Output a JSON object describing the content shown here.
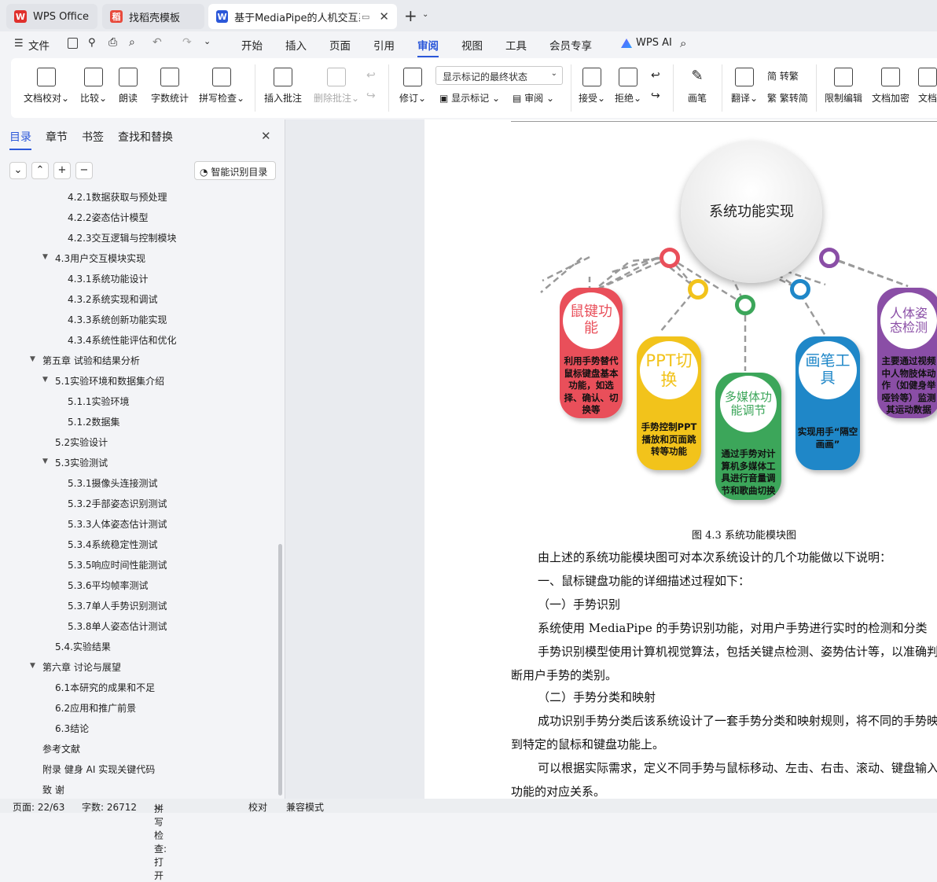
{
  "tabs": [
    {
      "label": "WPS Office"
    },
    {
      "label": "找稻壳模板"
    },
    {
      "label": "基于MediaPipe的人机交互系"
    }
  ],
  "menu": {
    "file": "文件",
    "items": [
      "开始",
      "插入",
      "页面",
      "引用",
      "审阅",
      "视图",
      "工具",
      "会员专享"
    ],
    "ai": "WPS AI"
  },
  "ribbon": {
    "proof": "文档校对",
    "compare": "比较",
    "read": "朗读",
    "wordcount": "字数统计",
    "spell": "拼写检查",
    "insert_comment": "插入批注",
    "delete_comment": "删除批注",
    "revise": "修订",
    "markup_select": "显示标记的最终状态",
    "show_markup": "显示标记",
    "review": "审阅",
    "accept": "接受",
    "reject": "拒绝",
    "pen": "画笔",
    "translate": "翻译",
    "to_trad": "转繁",
    "to_simp": "繁转简",
    "restrict": "限制编辑",
    "encrypt": "文档加密",
    "more": "文档"
  },
  "panel": {
    "tabs": [
      "目录",
      "章节",
      "书签",
      "查找和替换"
    ],
    "smart_toc": "智能识别目录"
  },
  "toc": [
    {
      "text": "4.2.1数据获取与预处理",
      "level": 3
    },
    {
      "text": "4.2.2姿态估计模型",
      "level": 3
    },
    {
      "text": "4.2.3交互逻辑与控制模块",
      "level": 3
    },
    {
      "text": "4.3用户交互模块实现",
      "level": 2,
      "arrow": true
    },
    {
      "text": "4.3.1系统功能设计",
      "level": 3
    },
    {
      "text": "4.3.2系统实现和调试",
      "level": 3
    },
    {
      "text": "4.3.3系统创新功能实现",
      "level": 3
    },
    {
      "text": "4.3.4系统性能评估和优化",
      "level": 3
    },
    {
      "text": "第五章 试验和结果分析",
      "level": 1,
      "arrow": true
    },
    {
      "text": "5.1实验环境和数据集介绍",
      "level": 2,
      "arrow": true
    },
    {
      "text": "5.1.1实验环境",
      "level": 3
    },
    {
      "text": "5.1.2数据集",
      "level": 3
    },
    {
      "text": "5.2实验设计",
      "level": 2
    },
    {
      "text": "5.3实验测试",
      "level": 2,
      "arrow": true
    },
    {
      "text": "5.3.1摄像头连接测试",
      "level": 3
    },
    {
      "text": "5.3.2手部姿态识别测试",
      "level": 3
    },
    {
      "text": "5.3.3人体姿态估计测试",
      "level": 3
    },
    {
      "text": "5.3.4系统稳定性测试",
      "level": 3
    },
    {
      "text": "5.3.5响应时间性能测试",
      "level": 3
    },
    {
      "text": "5.3.6平均帧率测试",
      "level": 3
    },
    {
      "text": "5.3.7单人手势识别测试",
      "level": 3
    },
    {
      "text": "5.3.8单人姿态估计测试",
      "level": 3
    },
    {
      "text": "5.4.实验结果",
      "level": 2
    },
    {
      "text": "第六章 讨论与展望",
      "level": 1,
      "arrow": true
    },
    {
      "text": "6.1本研究的成果和不足",
      "level": 2
    },
    {
      "text": "6.2应用和推广前景",
      "level": 2
    },
    {
      "text": "6.3结论",
      "level": 2
    },
    {
      "text": "参考文献",
      "level": 1
    },
    {
      "text": "附录 健身 AI 实现关键代码",
      "level": 1
    },
    {
      "text": "致 谢",
      "level": 1
    }
  ],
  "figure": {
    "center": "系统功能实现",
    "caption": "图 4.3 系统功能模块图",
    "modules": [
      {
        "title": "鼠键功能",
        "desc": "利用手势替代鼠标键盘基本功能，如选择、确认、切换等",
        "color": "#e94f5a"
      },
      {
        "title": "PPT切换",
        "desc": "手势控制PPT播放和页面跳转等功能",
        "color": "#f2c31b"
      },
      {
        "title": "多媒体功能调节",
        "desc": "通过手势对计算机多媒体工具进行音量调节和歌曲切换",
        "color": "#3ca65a"
      },
      {
        "title": "画笔工具",
        "desc": "实现用手“隔空画画”",
        "color": "#1f87c8"
      },
      {
        "title": "人体姿态检测",
        "desc": "主要通过视频中人物肢体动作（如健身举哑铃等）监测其运动数据",
        "color": "#8a4ea6"
      }
    ]
  },
  "doc": {
    "p1": "由上述的系统功能模块图可对本次系统设计的几个功能做以下说明：",
    "p2": "一、鼠标键盘功能的详细描述过程如下：",
    "p3": "（一）手势识别",
    "p4": "系统使用 MediaPipe 的手势识别功能，对用户手势进行实时的检测和分类",
    "p5": "手势识别模型使用计算机视觉算法，包括关键点检测、姿势估计等，以准确判",
    "p6": "断用户手势的类别。",
    "p7": "（二）手势分类和映射",
    "p8": "成功识别手势分类后该系统设计了一套手势分类和映射规则，将不同的手势映",
    "p9": "到特定的鼠标和键盘功能上。",
    "p10": "可以根据实际需求，定义不同手势与鼠标移动、左击、右击、滚动、键盘输入",
    "p11": "功能的对应关系。"
  },
  "status": {
    "page": "页面: 22/63",
    "words": "字数: 26712",
    "spell": "拼写检查: 打开",
    "proof": "校对",
    "compat": "兼容模式"
  }
}
